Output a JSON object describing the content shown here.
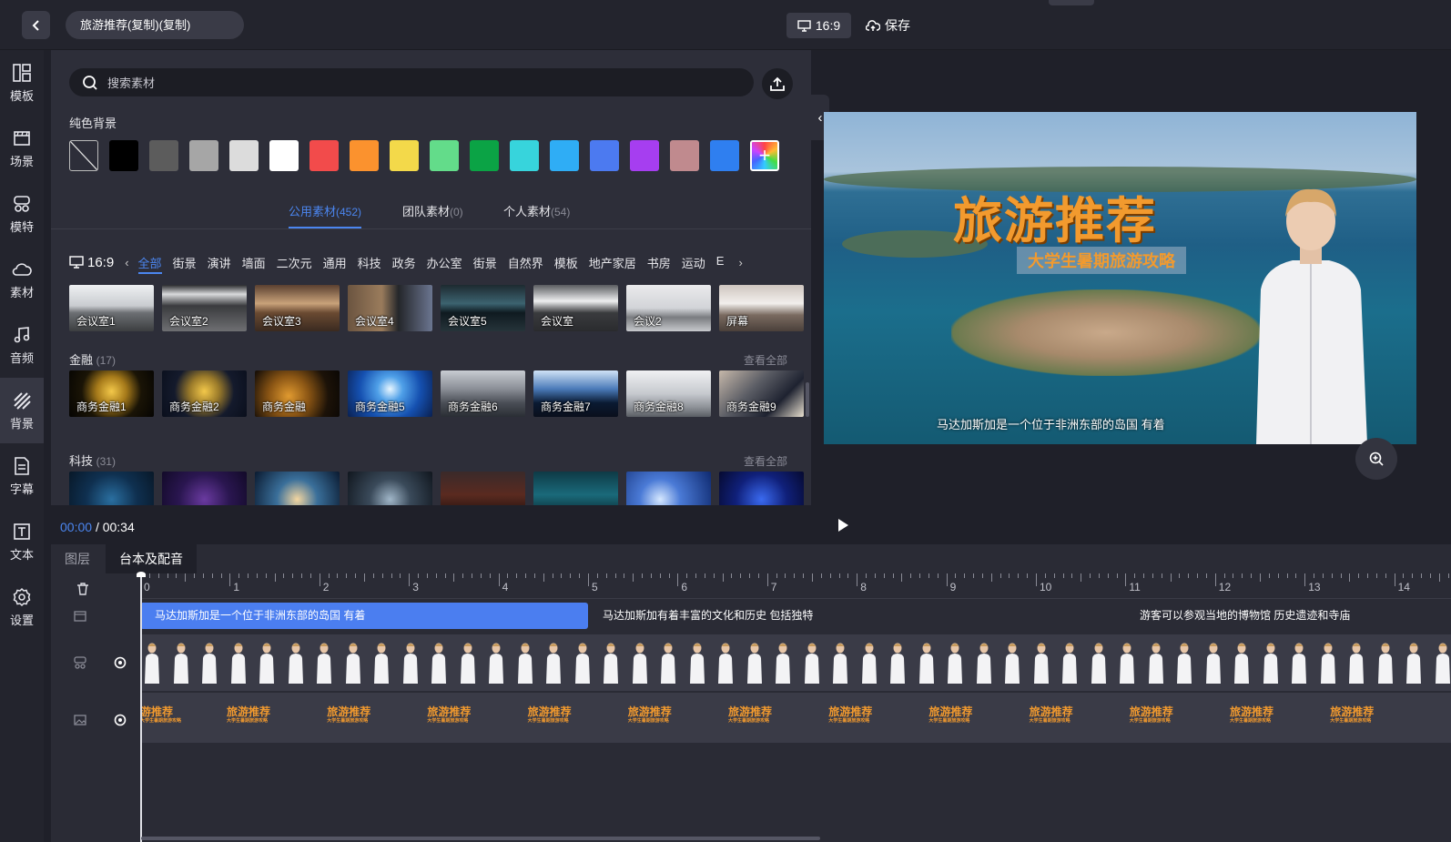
{
  "topbar": {
    "back_icon": "chevron-left-icon",
    "project_title": "旅游推荐(复制)(复制)",
    "ratio_label": "16:9",
    "save_label": "保存"
  },
  "sidebar": {
    "items": [
      {
        "label": "模板",
        "icon": "template-icon"
      },
      {
        "label": "场景",
        "icon": "scene-icon"
      },
      {
        "label": "模特",
        "icon": "avatar-icon"
      },
      {
        "label": "素材",
        "icon": "cloud-icon"
      },
      {
        "label": "音频",
        "icon": "music-icon"
      },
      {
        "label": "背景",
        "icon": "background-icon"
      },
      {
        "label": "字幕",
        "icon": "subtitle-icon"
      },
      {
        "label": "文本",
        "icon": "text-icon"
      },
      {
        "label": "设置",
        "icon": "settings-icon"
      }
    ],
    "active": "背景"
  },
  "panel": {
    "search_placeholder": "搜索素材",
    "solid_bg_label": "纯色背景",
    "swatches": [
      "none",
      "#000000",
      "#5c5c5c",
      "#a6a6a6",
      "#dcdcdc",
      "#ffffff",
      "#f24b4b",
      "#fb922e",
      "#f3d94a",
      "#63dc8a",
      "#0ba345",
      "#37d4dc",
      "#2fadf5",
      "#4c7af0",
      "#a63ef0",
      "#c08a8e",
      "#2f7ff0",
      "rainbow"
    ],
    "tabs": [
      {
        "label": "公用素材",
        "count": "(452)"
      },
      {
        "label": "团队素材",
        "count": "(0)"
      },
      {
        "label": "个人素材",
        "count": "(54)"
      }
    ],
    "ratio": "16:9",
    "categories": [
      "全部",
      "街景",
      "演讲",
      "墙面",
      "二次元",
      "通用",
      "科技",
      "政务",
      "办公室",
      "街景",
      "自然界",
      "模板",
      "地产家居",
      "书房",
      "运动",
      "E"
    ],
    "top_row": [
      "会议室1",
      "会议室2",
      "会议室3",
      "会议室4",
      "会议室5",
      "会议室",
      "会议2",
      "屏幕"
    ],
    "groups": [
      {
        "title": "金融",
        "count": "(17)",
        "see_all": "查看全部",
        "items": [
          "商务金融1",
          "商务金融2",
          "商务金融",
          "商务金融5",
          "商务金融6",
          "商务金融7",
          "商务金融8",
          "商务金融9"
        ]
      },
      {
        "title": "科技",
        "count": "(31)",
        "see_all": "查看全部",
        "items": []
      }
    ]
  },
  "preview": {
    "title": "旅游推荐",
    "subtitle": "大学生暑期旅游攻略",
    "caption": "马达加斯加是一个位于非洲东部的岛国 有着",
    "zoom_icon": "zoom-in-icon"
  },
  "timeline": {
    "current": "00:00",
    "total": "/ 00:34",
    "tabs": [
      "图层",
      "台本及配音"
    ],
    "ruler": [
      "0",
      "1",
      "2",
      "3",
      "4",
      "5",
      "6",
      "7",
      "8",
      "9",
      "10",
      "11",
      "12",
      "13",
      "14"
    ],
    "subtitle_clips": [
      "马达加斯加是一个位于非洲东部的岛国 有着",
      "马达加斯加有着丰富的文化和历史 包括独特",
      "游客可以参观当地的博物馆 历史遗迹和寺庙"
    ],
    "title_chip_text": "旅游推荐",
    "title_chip_first": "游推荐",
    "title_chip_sub": "大学生暑期旅游攻略"
  }
}
